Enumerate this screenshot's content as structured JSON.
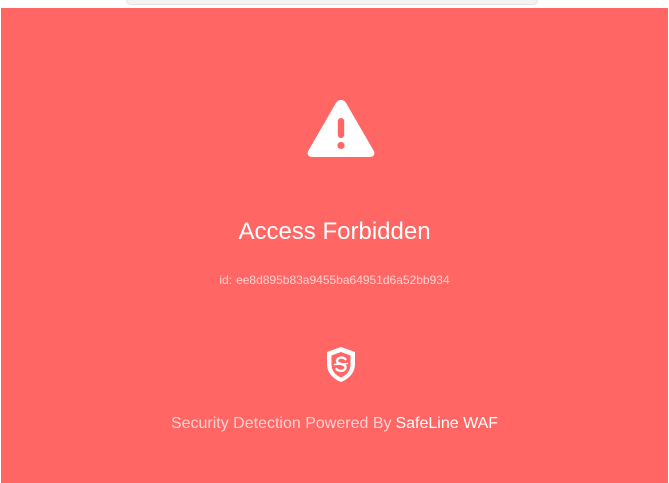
{
  "page": {
    "background_color": "#ff6664",
    "title": "Access Forbidden",
    "request_id_label": "id:",
    "request_id": "ee8d895b83a9455ba64951d6a52bb934"
  },
  "icons": {
    "warning": "warning-triangle-icon",
    "shield": "safeline-shield-icon"
  },
  "footer": {
    "prefix": "Security Detection Powered By",
    "brand_link": "SafeLine WAF"
  }
}
